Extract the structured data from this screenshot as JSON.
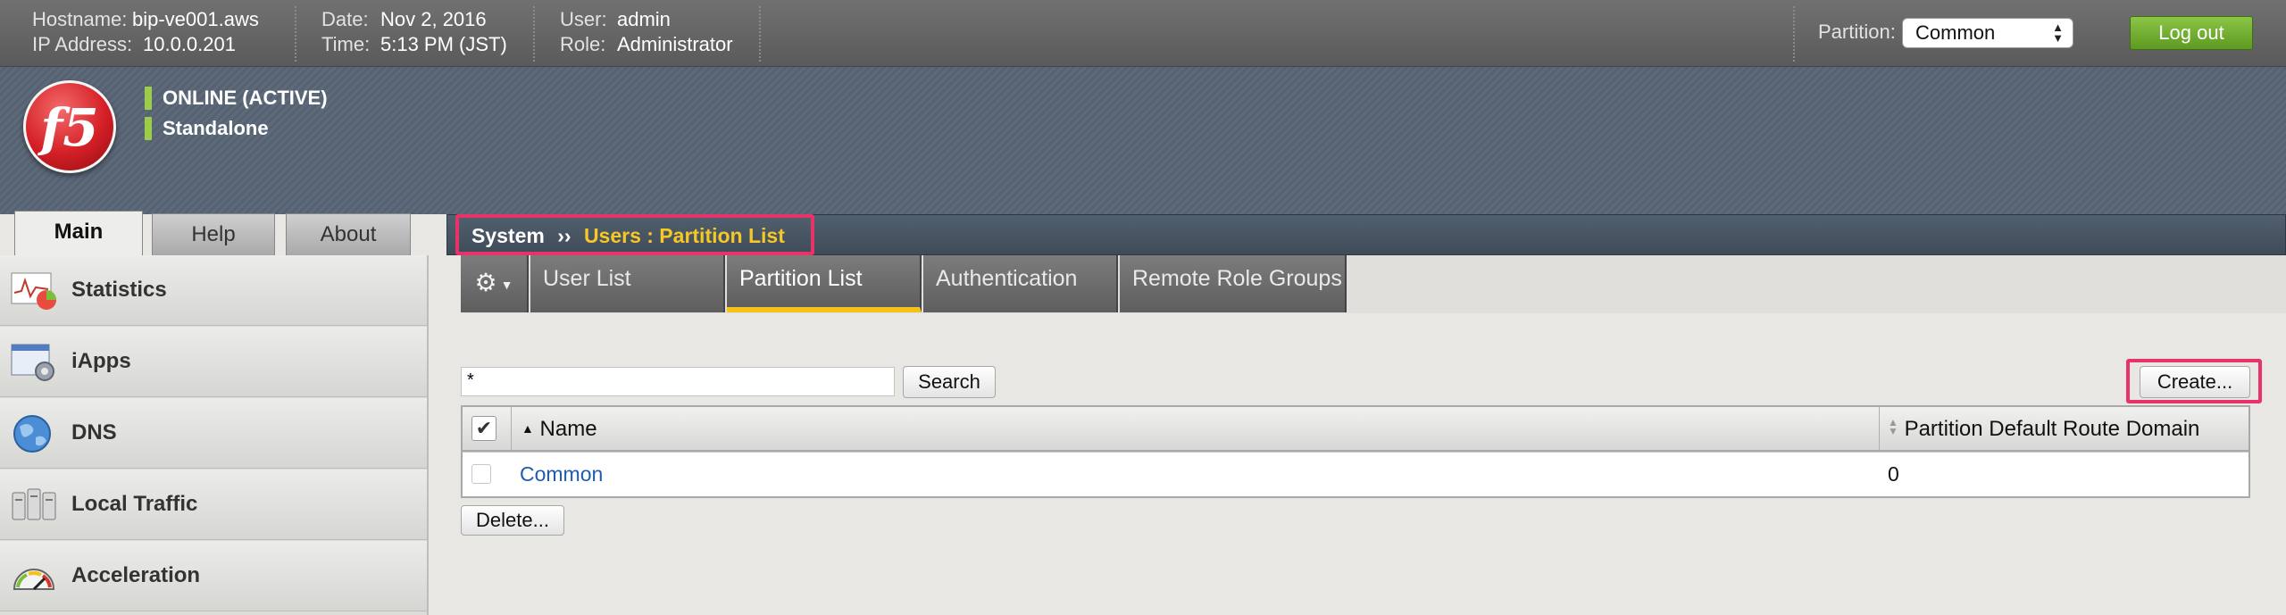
{
  "topbar": {
    "hostname_label": "Hostname:",
    "hostname": "bip-ve001.aws",
    "ip_label": "IP Address:",
    "ip": "10.0.0.201",
    "date_label": "Date:",
    "date": "Nov 2, 2016",
    "time_label": "Time:",
    "time": "5:13 PM (JST)",
    "user_label": "User:",
    "user": "admin",
    "role_label": "Role:",
    "role": "Administrator",
    "partition_label": "Partition:",
    "partition_value": "Common",
    "logout_label": "Log out"
  },
  "banner": {
    "logo_text": "f5",
    "status_online": "ONLINE (ACTIVE)",
    "status_mode": "Standalone",
    "status_color": "#9bcd4a"
  },
  "main_tabs": [
    {
      "label": "Main",
      "active": true
    },
    {
      "label": "Help",
      "active": false
    },
    {
      "label": "About",
      "active": false
    }
  ],
  "breadcrumb": {
    "section": "System",
    "separator": "››",
    "current": "Users : Partition List"
  },
  "sidebar": {
    "items": [
      {
        "label": "Statistics",
        "icon": "statistics-icon"
      },
      {
        "label": "iApps",
        "icon": "iapps-icon"
      },
      {
        "label": "DNS",
        "icon": "dns-globe-icon"
      },
      {
        "label": "Local Traffic",
        "icon": "local-traffic-icon"
      },
      {
        "label": "Acceleration",
        "icon": "acceleration-gauge-icon"
      }
    ]
  },
  "subtabs": {
    "gear_icon": "gear-icon",
    "items": [
      {
        "label": "User List",
        "active": false
      },
      {
        "label": "Partition List",
        "active": true
      },
      {
        "label": "Authentication",
        "active": false
      },
      {
        "label": "Remote Role Groups",
        "active": false
      }
    ]
  },
  "search": {
    "value": "*",
    "button_label": "Search"
  },
  "create_button_label": "Create...",
  "table": {
    "columns": [
      "Name",
      "Partition Default Route Domain"
    ],
    "rows": [
      {
        "name": "Common",
        "route_domain": "0"
      }
    ]
  },
  "delete_button_label": "Delete...",
  "colors": {
    "accent_yellow": "#f4c21a",
    "highlight_pink": "#e7336a",
    "link_blue": "#1e5cb3",
    "logout_green": "#6aa82e"
  }
}
